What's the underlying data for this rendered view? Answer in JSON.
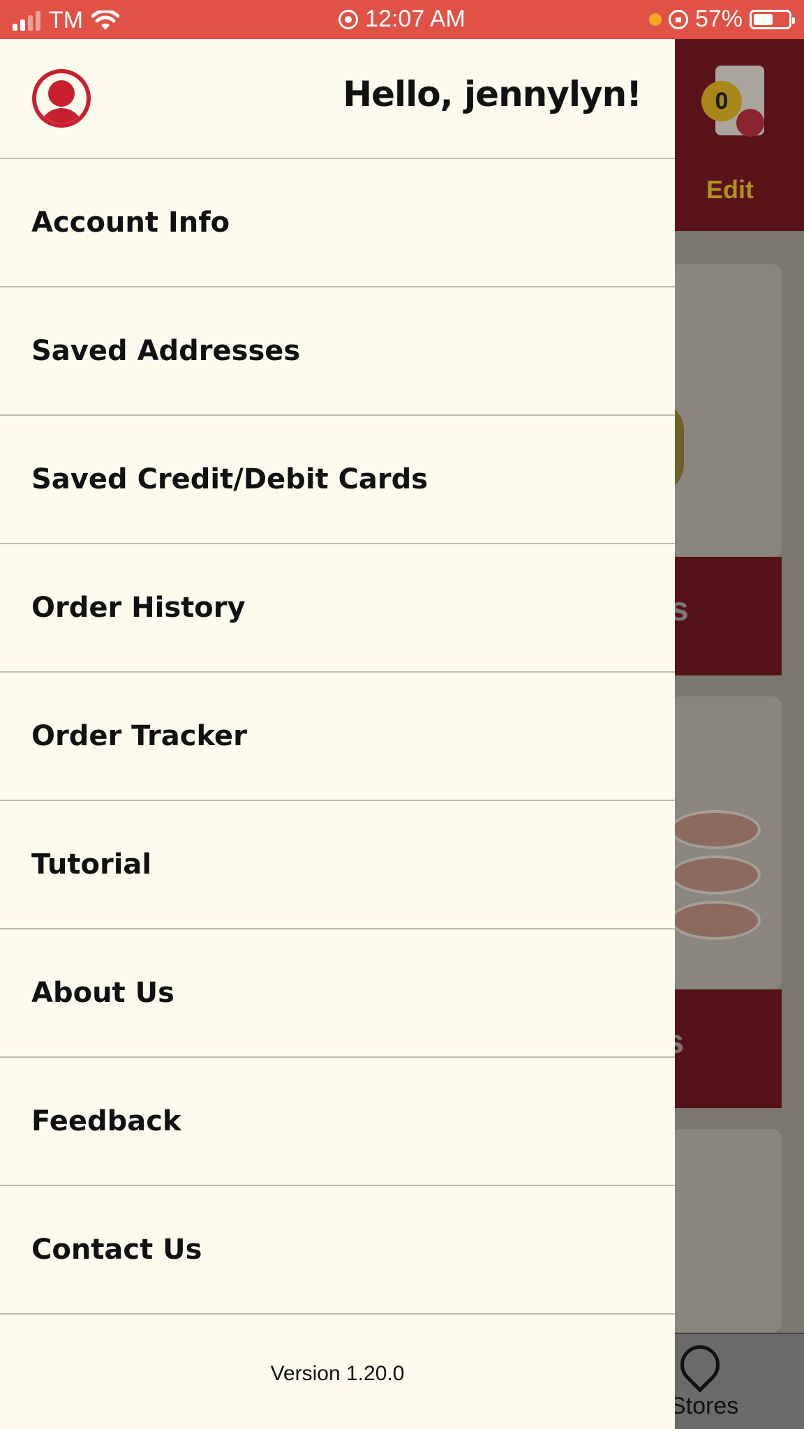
{
  "status_bar": {
    "carrier": "TM",
    "time": "12:07 AM",
    "battery": "57%",
    "battery_level": 0.57,
    "icons": [
      "signal-icon",
      "wifi-icon",
      "screen-record-icon",
      "orientation-lock-icon",
      "battery-icon"
    ]
  },
  "background": {
    "cart_count": "0",
    "edit_label": "Edit",
    "band_1_fragment": "s",
    "band_2_fragment": "ls",
    "nav_stores_label": "Stores"
  },
  "drawer": {
    "greeting": "Hello, jennylyn!",
    "menu_items": [
      {
        "label": "Account Info"
      },
      {
        "label": "Saved Addresses"
      },
      {
        "label": "Saved Credit/Debit Cards"
      },
      {
        "label": "Order History"
      },
      {
        "label": "Order Tracker"
      },
      {
        "label": "Tutorial"
      },
      {
        "label": "About Us"
      },
      {
        "label": "Feedback"
      },
      {
        "label": "Contact Us"
      }
    ],
    "version": "Version 1.20.0"
  },
  "colors": {
    "status_bar": "#e05245",
    "drawer_bg": "#fcfbee",
    "avatar_red": "#c8202f",
    "header_dark_red": "#5a1319"
  }
}
